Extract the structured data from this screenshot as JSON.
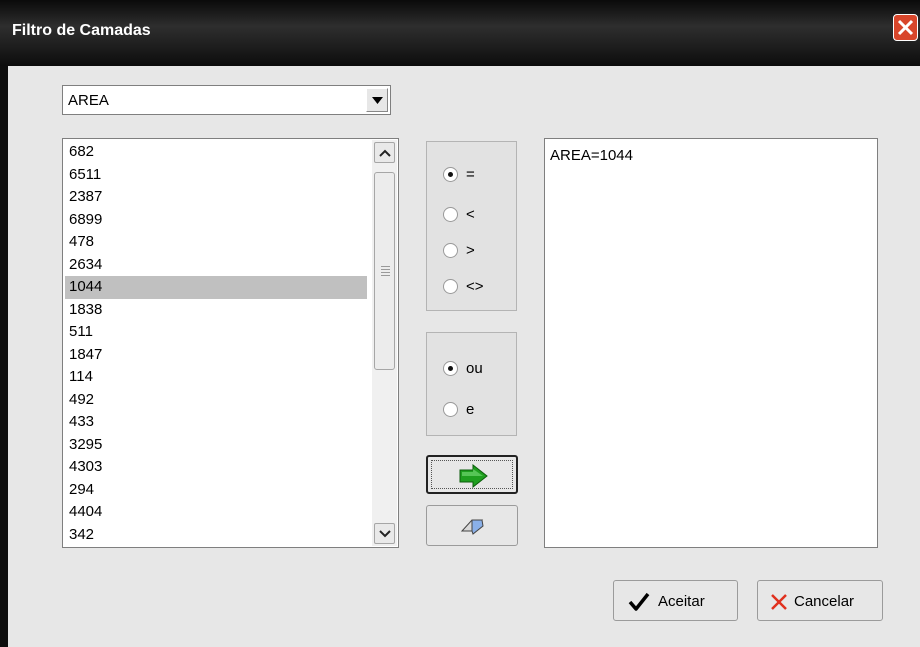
{
  "window": {
    "title": "Filtro de Camadas"
  },
  "field_select": {
    "selected": "AREA"
  },
  "values_list": {
    "items": [
      "682",
      "6511",
      "2387",
      "6899",
      "478",
      "2634",
      "1044",
      "1838",
      "511",
      "1847",
      "114",
      "492",
      "433",
      "3295",
      "4303",
      "294",
      "4404",
      "342"
    ],
    "selected_index": 6
  },
  "operators": {
    "options": [
      "=",
      "<",
      ">",
      "<>"
    ],
    "selected": "="
  },
  "connectors": {
    "options": [
      "ou",
      "e"
    ],
    "selected": "ou"
  },
  "actions": {
    "add_icon": "green-arrow-right-icon",
    "clear_icon": "eraser-icon"
  },
  "expression": {
    "text": "AREA=1044"
  },
  "footer": {
    "accept_label": "Aceitar",
    "accept_icon": "checkmark-icon",
    "cancel_label": "Cancelar",
    "cancel_icon": "x-icon"
  },
  "colors": {
    "accent_green": "#1f9f1f",
    "cancel_red": "#e0301e",
    "selection": "#c0c0c0"
  }
}
